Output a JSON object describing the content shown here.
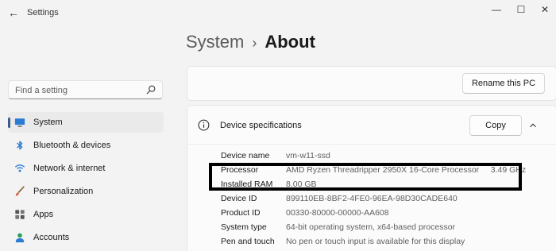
{
  "window": {
    "title": "Settings",
    "controls": {
      "minimize": "—",
      "maximize": "☐",
      "close": "✕"
    }
  },
  "breadcrumb": {
    "parent": "System",
    "separator": "›",
    "current": "About"
  },
  "search": {
    "placeholder": "Find a setting",
    "icon": "search-icon"
  },
  "sidebar": {
    "items": [
      {
        "label": "System",
        "icon": "monitor-icon",
        "selected": true
      },
      {
        "label": "Bluetooth & devices",
        "icon": "bluetooth-icon"
      },
      {
        "label": "Network & internet",
        "icon": "wifi-icon"
      },
      {
        "label": "Personalization",
        "icon": "brush-icon"
      },
      {
        "label": "Apps",
        "icon": "apps-icon"
      },
      {
        "label": "Accounts",
        "icon": "account-icon"
      }
    ]
  },
  "rename": {
    "button_label": "Rename this PC"
  },
  "device_specs": {
    "title": "Device specifications",
    "copy_label": "Copy",
    "rows": [
      {
        "key": "Device name",
        "value": "vm-w11-ssd"
      },
      {
        "key": "Processor",
        "value": "AMD Ryzen Threadripper 2950X 16-Core Processor     3.49 GHz"
      },
      {
        "key": "Installed RAM",
        "value": "8.00 GB"
      },
      {
        "key": "Device ID",
        "value": "899110EB-8BF2-4FE0-96EA-98D30CADE640"
      },
      {
        "key": "Product ID",
        "value": "00330-80000-00000-AA608"
      },
      {
        "key": "System type",
        "value": "64-bit operating system, x64-based processor"
      },
      {
        "key": "Pen and touch",
        "value": "No pen or touch input is available for this display"
      }
    ]
  },
  "colors": {
    "accent": "#3a5b8c",
    "highlight_border": "#000000",
    "background": "#f3f3f3"
  }
}
